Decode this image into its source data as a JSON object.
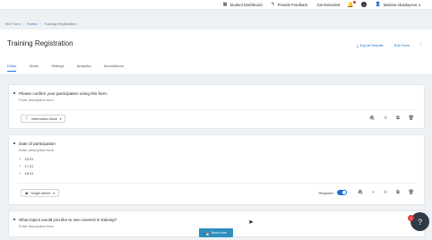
{
  "topbar": {
    "items": [
      {
        "icon": "grid-icon",
        "label": "Student Dashboard"
      },
      {
        "icon": "feedback-icon",
        "label": "Provide Feedback"
      },
      {
        "icon": "",
        "label": "Get Extended"
      }
    ],
    "bell_icon": "bell-icon",
    "help_label": "?",
    "user_name": "Malvina Abdulayeva",
    "accent": "#1d6fd8"
  },
  "breadcrumb": {
    "items": [
      "Test Form",
      "Forms",
      "Training Registration"
    ]
  },
  "header": {
    "title": "Training Registration",
    "buttons": [
      {
        "icon": "download-icon",
        "label": "Export Results"
      },
      {
        "icon": "",
        "label": "Edit Form"
      }
    ],
    "tabs": [
      "Editor",
      "Share",
      "Settings",
      "Analytics",
      "Automations"
    ],
    "active_tab": "Editor"
  },
  "questions": [
    {
      "title": "Please confirm your participation using this form.",
      "description": "Form description here",
      "type_label": "Information block"
    },
    {
      "title": "Date of participation",
      "description": "Enter description here",
      "options": [
        "15.01",
        "17.01",
        "18.01"
      ],
      "type_label": "Single-select",
      "required_label": "Required",
      "required": true
    },
    {
      "title": "What topics would you like to see covered in training?",
      "description": "Enter description here"
    }
  ],
  "save_button": {
    "label": "Save form"
  },
  "help_fab": {
    "label": "?",
    "badge": "2"
  }
}
